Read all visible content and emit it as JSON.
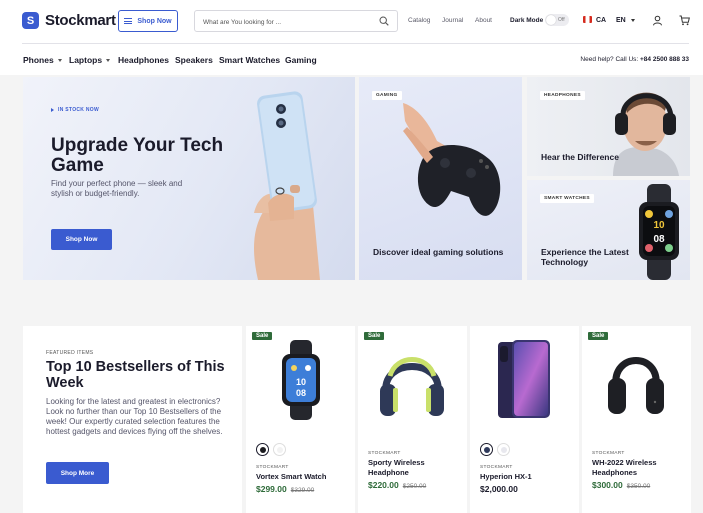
{
  "header": {
    "logo_text": "Stockmart",
    "shop_now_label": "Shop Now",
    "search_placeholder": "What are You looking for ...",
    "links": [
      "Catalog",
      "Journal",
      "About"
    ],
    "dark_mode_label": "Dark Mode",
    "toggle_state": "Off",
    "country": "CA",
    "language": "EN"
  },
  "nav": {
    "categories": [
      {
        "label": "Phones"
      },
      {
        "label": "Laptops"
      },
      {
        "label": "Headphones"
      },
      {
        "label": "Speakers"
      },
      {
        "label": "Smart Watches"
      },
      {
        "label": "Gaming"
      }
    ],
    "help_text": "Need help? Call Us:",
    "help_phone": "+84 2500 888 33"
  },
  "hero": {
    "badge": "IN STOCK NOW",
    "title": "Upgrade Your Tech Game",
    "subtitle": "Find your perfect phone — sleek and stylish or budget-friendly.",
    "button": "Shop Now"
  },
  "tiles": [
    {
      "badge": "GAMING",
      "title": "Discover ideal gaming solutions"
    },
    {
      "badge": "HEADPHONES",
      "title": "Hear the Difference"
    },
    {
      "badge": "SMART WATCHES",
      "title": "Experience the Latest Technology"
    }
  ],
  "bestsellers": {
    "eyebrow": "FEATURED ITEMS",
    "title": "Top 10 Bestsellers of This Week",
    "body": "Looking for the latest and greatest in electronics? Look no further than our Top 10 Bestsellers of the week! Our expertly curated selection features the hottest gadgets and devices flying off the shelves.",
    "button": "Shop More"
  },
  "products": [
    {
      "sale": "Sale",
      "brand": "STOCKMART",
      "name": "Vortex Smart Watch",
      "price": "$299.00",
      "old_price": "$329.00"
    },
    {
      "sale": "Sale",
      "brand": "STOCKMART",
      "name": "Sporty Wireless Headphone",
      "price": "$220.00",
      "old_price": "$250.00"
    },
    {
      "sale": "",
      "brand": "STOCKMART",
      "name": "Hyperion HX-1",
      "price": "$2,000.00",
      "old_price": ""
    },
    {
      "sale": "Sale",
      "brand": "STOCKMART",
      "name": "WH-2022 Wireless Headphones",
      "price": "$300.00",
      "old_price": "$350.00"
    }
  ],
  "colors": {
    "accent": "#3a5bd0",
    "sale": "#2f6b3a",
    "price_green": "#2f6b3a"
  }
}
